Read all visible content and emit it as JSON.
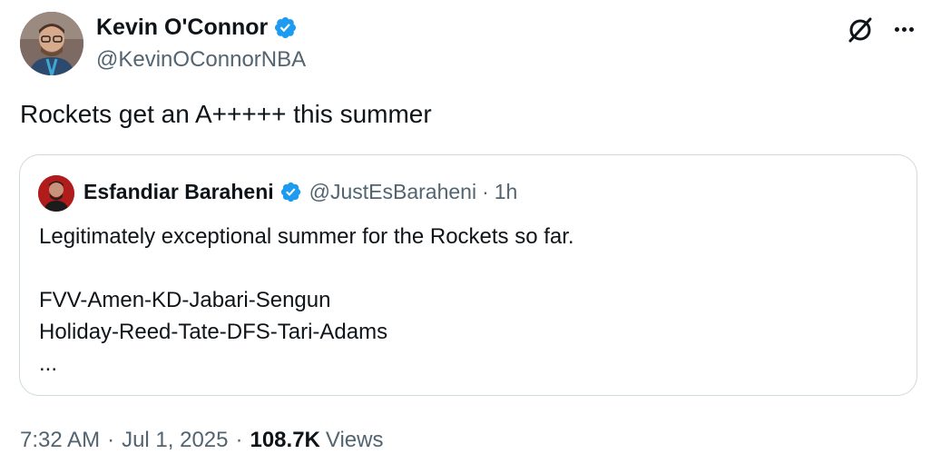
{
  "author": {
    "name": "Kevin O'Connor",
    "handle": "@KevinOConnorNBA",
    "verified_color": "#1d9bf0"
  },
  "header_icons": [
    "grok-icon",
    "more-icon"
  ],
  "tweet": {
    "text": "Rockets get an A+++++ this summer"
  },
  "quoted": {
    "name": "Esfandiar Baraheni",
    "handle": "@JustEsBaraheni",
    "separator": "·",
    "time": "1h",
    "lines": [
      "Legitimately exceptional summer for the Rockets so far.",
      "",
      "FVV-Amen-KD-Jabari-Sengun",
      "Holiday-Reed-Tate-DFS-Tari-Adams",
      "..."
    ]
  },
  "meta": {
    "time": "7:32 AM",
    "separator": "·",
    "date": "Jul 1, 2025",
    "views_count": "108.7K",
    "views_label": "Views"
  },
  "colors": {
    "text": "#0f1419",
    "secondary": "#536471",
    "border": "#cfd9de",
    "verified": "#1d9bf0"
  }
}
